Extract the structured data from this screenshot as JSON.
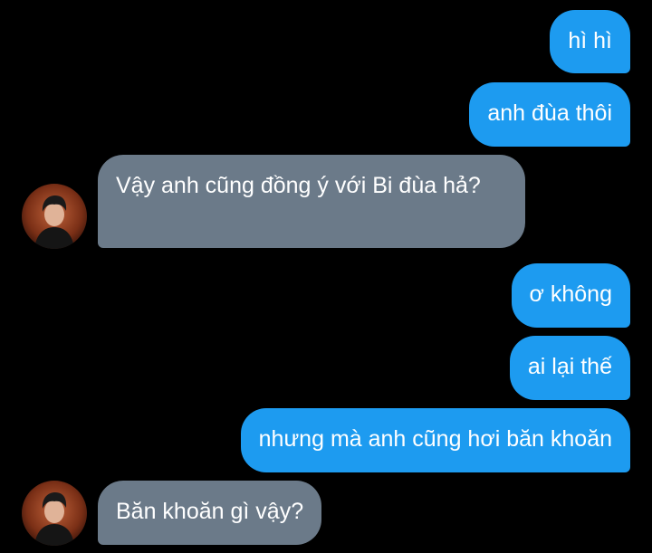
{
  "conversation": {
    "colors": {
      "background": "#000000",
      "outgoing_bubble": "#1d9bf0",
      "incoming_bubble": "#6b7a89",
      "text": "#ffffff"
    },
    "messages": [
      {
        "sender": "me",
        "text": "hì hì"
      },
      {
        "sender": "me",
        "text": "anh đùa thôi"
      },
      {
        "sender": "contact",
        "text": "Vậy anh cũng đồng ý với Bi đùa hả?"
      },
      {
        "sender": "me",
        "text": "ơ không"
      },
      {
        "sender": "me",
        "text": "ai lại thế"
      },
      {
        "sender": "me",
        "text": "nhưng mà anh cũng hơi băn khoăn"
      },
      {
        "sender": "contact",
        "text": "Băn khoăn gì vậy?"
      }
    ]
  }
}
